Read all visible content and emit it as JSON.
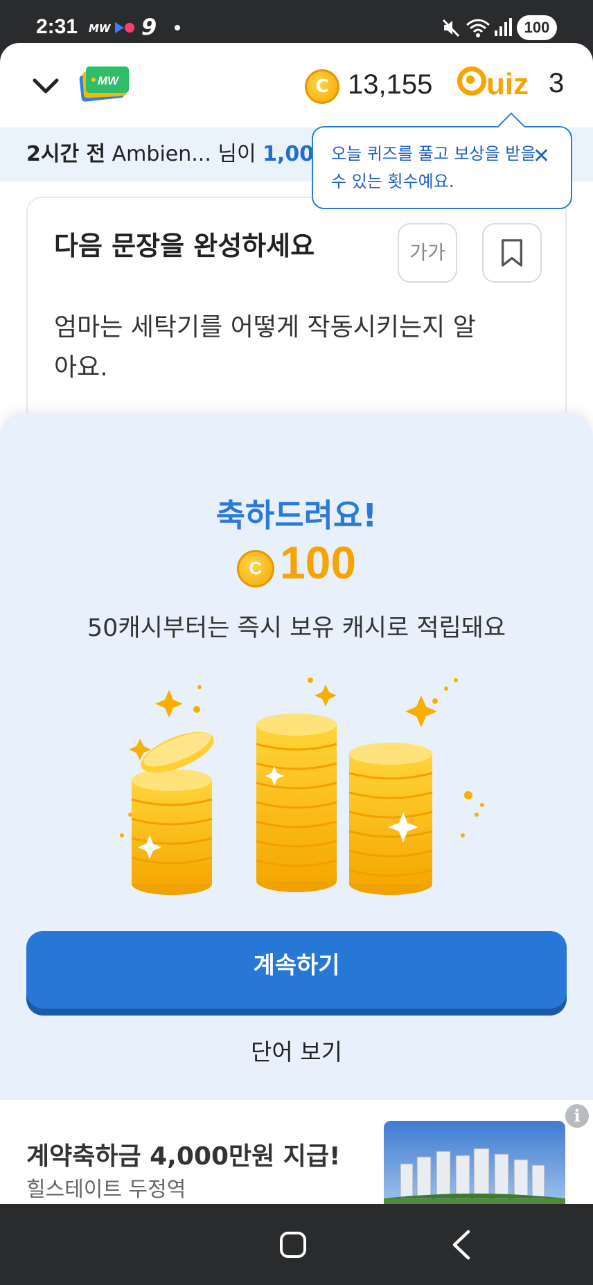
{
  "status_bar": {
    "time": "2:31",
    "app_indicator": "MW",
    "battery": "100",
    "icons": [
      "mw-notification-icon",
      "media-play-icon",
      "recording-dot-icon",
      "app-nine-icon",
      "mute-icon",
      "wifi-icon",
      "signal-icon"
    ]
  },
  "header": {
    "logo": "MW",
    "coin_balance": "13,155",
    "quiz_logo_text": "uiz",
    "quiz_count": "3"
  },
  "ticker": {
    "time_ago": "2시간 전",
    "text": " Ambien... 님이 ",
    "amount": "1,00"
  },
  "tooltip": {
    "text": "오늘 퀴즈를 풀고 보상을 받을 수 있는 횟수예요.",
    "close_label": "✕"
  },
  "question": {
    "title": "다음 문장을 완성하세요",
    "font_button": "가가",
    "sentence": "엄마는 세탁기를 어떻게 작동시키는지 알아요."
  },
  "reward": {
    "title": "축하드려요!",
    "amount": "100",
    "notice": "50캐시부터는 즉시 보유 캐시로 적립돼요",
    "continue_label": "계속하기",
    "view_words_label": "단어 보기"
  },
  "ad": {
    "title": "계약축하금 4,000만원 지급!",
    "subtitle": "힐스테이트 두정역",
    "info_label": "i"
  },
  "colors": {
    "accent_blue": "#2677d6",
    "coin_gold": "#f7a400",
    "sheet_bg": "#e8f1fb"
  }
}
